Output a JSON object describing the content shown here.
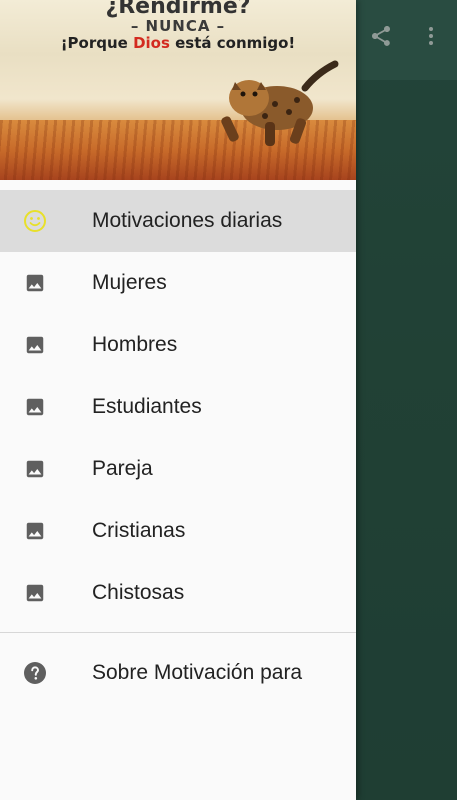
{
  "header": {
    "line1": "¿Rendirme?",
    "line2": "– NUNCA –",
    "line3_before": "¡Porque ",
    "line3_highlight": "Dios",
    "line3_after": " está conmigo!"
  },
  "menu": {
    "items": [
      {
        "label": "Motivaciones diarias",
        "icon": "smiley-icon",
        "active": true
      },
      {
        "label": "Mujeres",
        "icon": "image-icon"
      },
      {
        "label": "Hombres",
        "icon": "image-icon"
      },
      {
        "label": "Estudiantes",
        "icon": "image-icon"
      },
      {
        "label": "Pareja",
        "icon": "image-icon"
      },
      {
        "label": "Cristianas",
        "icon": "image-icon"
      },
      {
        "label": "Chistosas",
        "icon": "image-icon"
      }
    ],
    "about": {
      "label": "Sobre Motivación para",
      "icon": "help-icon"
    }
  },
  "toolbar": {
    "icons": [
      "share-icon",
      "more-vert-icon"
    ]
  },
  "colors": {
    "accent_yellow": "#e8e02a",
    "icon_gray": "#5f5f5f",
    "active_bg": "#dcdcdc",
    "dios_red": "#d32a1f"
  }
}
